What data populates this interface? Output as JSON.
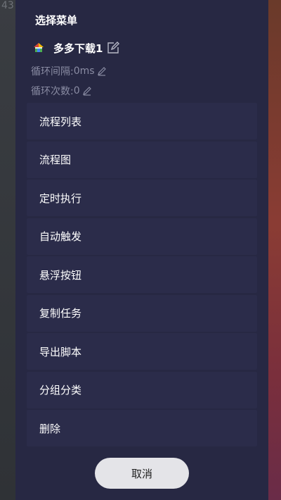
{
  "background": {
    "left_edge_text": "43"
  },
  "dialog": {
    "title": "选择菜单",
    "task": {
      "name": "多多下载1",
      "icon": "house-icon"
    },
    "interval": {
      "label": "循环间隔:",
      "value": "0ms"
    },
    "count": {
      "label": "循环次数:",
      "value": "0"
    },
    "menu_items": [
      {
        "label": "流程列表"
      },
      {
        "label": "流程图"
      },
      {
        "label": "定时执行"
      },
      {
        "label": "自动触发"
      },
      {
        "label": "悬浮按钮"
      },
      {
        "label": "复制任务"
      },
      {
        "label": "导出脚本"
      },
      {
        "label": "分组分类"
      },
      {
        "label": "删除"
      }
    ],
    "cancel_label": "取消"
  },
  "colors": {
    "sheet_bg": "#272843",
    "item_bg": "#2b2c4a",
    "muted_text": "#8a8ca3",
    "button_bg": "#e4e4e8"
  }
}
